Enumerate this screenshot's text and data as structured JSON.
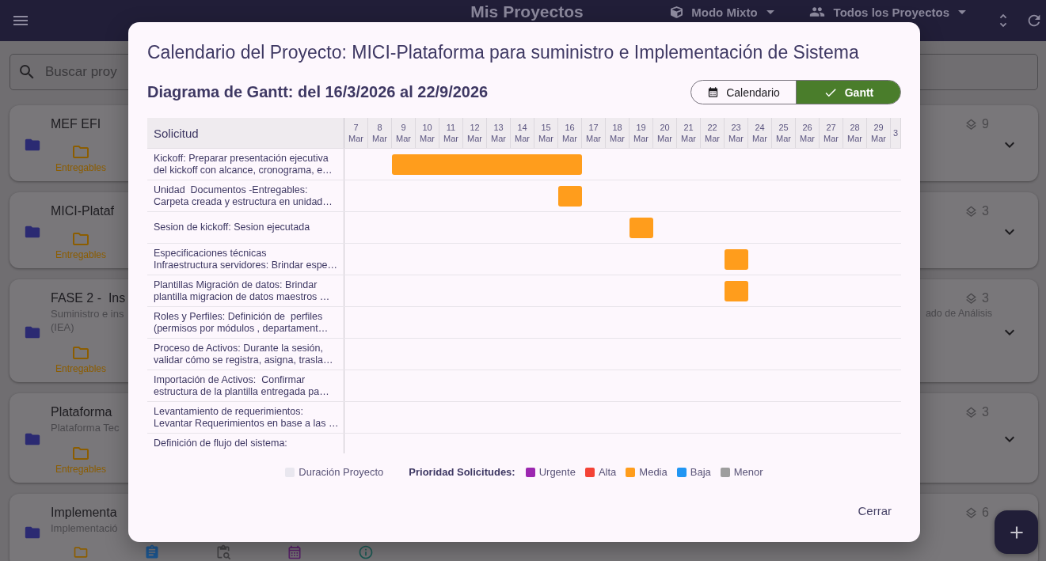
{
  "app_bar": {
    "title": "Mis Proyectos",
    "menus": [
      {
        "kind": "mode",
        "label": "Modo Mixto"
      },
      {
        "kind": "people",
        "label": "Todos los Proyectos"
      }
    ]
  },
  "search": {
    "placeholder": "Buscar proy"
  },
  "projects": [
    {
      "title": "MEF EFI",
      "count": "9",
      "actions": [
        {
          "kind": "deliverables",
          "label": "Entregables"
        }
      ]
    },
    {
      "title": "MICI-Plataf",
      "count": "3",
      "actions": [
        {
          "kind": "deliverables",
          "label": "Entregables"
        }
      ]
    },
    {
      "title": "FASE 2 -  Ins",
      "subtitle_lines": [
        "Suministro e ins",
        "(IEA)"
      ],
      "subtitle_tail": "ado de Análisis",
      "count": "3",
      "actions": [
        {
          "kind": "deliverables",
          "label": "Entregables"
        }
      ]
    },
    {
      "title": "Plataforma",
      "subtitle_lines": [
        "Plataforma Tec"
      ],
      "count": "3",
      "actions": [
        {
          "kind": "deliverables",
          "label": "Entregables"
        }
      ]
    },
    {
      "title": "Implementa",
      "subtitle_lines": [
        "Implementació"
      ],
      "count": "6",
      "actions": [
        {
          "kind": "deliverables"
        },
        {
          "kind": "tasks"
        },
        {
          "kind": "requests"
        },
        {
          "kind": "calendar"
        },
        {
          "kind": "info"
        }
      ]
    }
  ],
  "dialog": {
    "title": "Calendario del Proyecto: MICI-Plataforma para suministro e Implementación de Sistema",
    "subtitle": "Diagrama de Gantt: del 16/3/2026 al 22/9/2026",
    "view_toggle": [
      {
        "kind": "calendar",
        "label": "Calendario",
        "selected": false
      },
      {
        "kind": "gantt",
        "label": "Gantt",
        "selected": true
      }
    ],
    "gantt": {
      "column_header": "Solicitud",
      "dates": [
        {
          "day": "7",
          "month": "Mar"
        },
        {
          "day": "8",
          "month": "Mar"
        },
        {
          "day": "9",
          "month": "Mar"
        },
        {
          "day": "10",
          "month": "Mar"
        },
        {
          "day": "11",
          "month": "Mar"
        },
        {
          "day": "12",
          "month": "Mar"
        },
        {
          "day": "13",
          "month": "Mar"
        },
        {
          "day": "14",
          "month": "Mar"
        },
        {
          "day": "15",
          "month": "Mar"
        },
        {
          "day": "16",
          "month": "Mar"
        },
        {
          "day": "17",
          "month": "Mar"
        },
        {
          "day": "18",
          "month": "Mar"
        },
        {
          "day": "19",
          "month": "Mar"
        },
        {
          "day": "20",
          "month": "Mar"
        },
        {
          "day": "21",
          "month": "Mar"
        },
        {
          "day": "22",
          "month": "Mar"
        },
        {
          "day": "23",
          "month": "Mar"
        },
        {
          "day": "24",
          "month": "Mar"
        },
        {
          "day": "25",
          "month": "Mar"
        },
        {
          "day": "26",
          "month": "Mar"
        },
        {
          "day": "27",
          "month": "Mar"
        },
        {
          "day": "28",
          "month": "Mar"
        },
        {
          "day": "29",
          "month": "Mar"
        },
        {
          "day": "3"
        }
      ],
      "tasks": [
        {
          "label": "Kickoff: Preparar presentación ejecutiva\ndel kickoff con alcance, cronograma, e…",
          "kind": "media",
          "days": [
            false,
            false,
            true,
            true,
            true,
            true,
            true,
            true,
            true,
            true,
            false,
            false,
            false,
            false,
            false,
            false,
            false,
            false,
            false,
            false,
            false,
            false,
            false,
            false
          ]
        },
        {
          "label": "Unidad  Documentos -Entregables:\nCarpeta creada y estructura en unidad…",
          "kind": "media",
          "days": [
            false,
            false,
            false,
            false,
            false,
            false,
            false,
            false,
            false,
            true,
            false,
            false,
            false,
            false,
            false,
            false,
            false,
            false,
            false,
            false,
            false,
            false,
            false,
            false
          ]
        },
        {
          "label": "Sesion de kickoff: Sesion ejecutada",
          "kind": "media",
          "days": [
            false,
            false,
            false,
            false,
            false,
            false,
            false,
            false,
            false,
            false,
            false,
            false,
            true,
            false,
            false,
            false,
            false,
            false,
            false,
            false,
            false,
            false,
            false,
            false
          ]
        },
        {
          "label": "Especificaciones técnicas\nInfraestructura servidores: Brindar espe…",
          "kind": "media",
          "days": [
            false,
            false,
            false,
            false,
            false,
            false,
            false,
            false,
            false,
            false,
            false,
            false,
            false,
            false,
            false,
            false,
            true,
            false,
            false,
            false,
            false,
            false,
            false,
            false
          ]
        },
        {
          "label": "Plantillas Migración de datos: Brindar\nplantilla migracion de datos maestros …",
          "kind": "media",
          "days": [
            false,
            false,
            false,
            false,
            false,
            false,
            false,
            false,
            false,
            false,
            false,
            false,
            false,
            false,
            false,
            false,
            true,
            false,
            false,
            false,
            false,
            false,
            false,
            false
          ]
        },
        {
          "label": "Roles y Perfiles: Definición de  perfiles\n(permisos por módulos , departament…"
        },
        {
          "label": "Proceso de Activos: Durante la sesión,\nvalidar cómo se registra, asigna, trasla…"
        },
        {
          "label": "Importación de Activos:  Confirmar\nestructura de la plantilla entregada pa…"
        },
        {
          "label": "Levantamiento de requerimientos:\nLevantar Requerimientos en base a las …"
        },
        {
          "label": "Definición de flujo del sistema:"
        }
      ]
    },
    "legend": {
      "project_label": "Duración Proyecto",
      "priority_title": "Prioridad Solicitudes:",
      "priorities": [
        {
          "kind": "urgente",
          "label": "Urgente",
          "color": "#9c27b0"
        },
        {
          "kind": "alta",
          "label": "Alta",
          "color": "#f44336"
        },
        {
          "kind": "media",
          "label": "Media",
          "color": "#ff9d1c"
        },
        {
          "kind": "baja",
          "label": "Baja",
          "color": "#2196f3"
        },
        {
          "kind": "menor",
          "label": "Menor",
          "color": "#9e9e9e"
        }
      ]
    },
    "close_button": "Cerrar"
  }
}
